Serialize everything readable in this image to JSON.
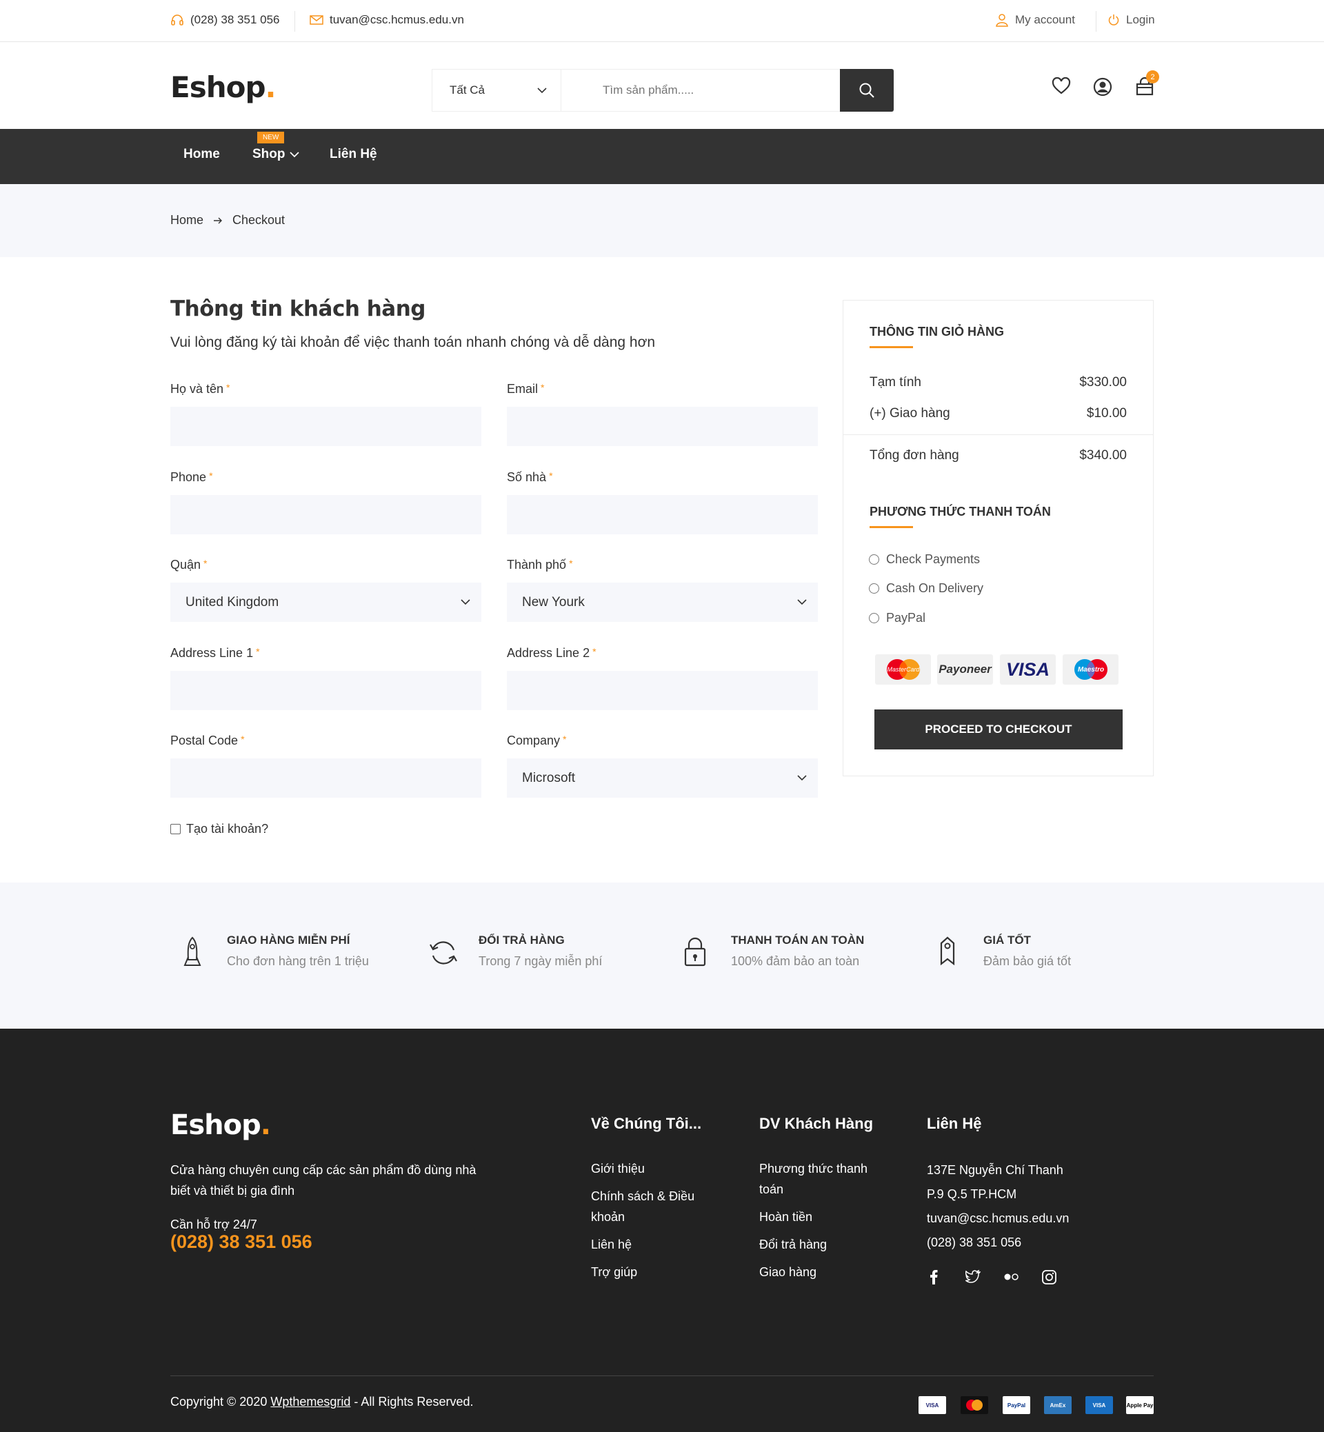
{
  "topbar": {
    "phone": "(028) 38 351 056",
    "email": "tuvan@csc.hcmus.edu.vn",
    "my_account": "My account",
    "login": "Login"
  },
  "header": {
    "logo_text": "Eshop",
    "logo_dot": ".",
    "search_category": "Tất Cả",
    "search_placeholder": "Tìm sản phẩm.....",
    "cart_count": "2"
  },
  "nav": {
    "items": [
      {
        "label": "Home"
      },
      {
        "label": "Shop",
        "tag": "NEW"
      },
      {
        "label": "Liên Hệ"
      }
    ]
  },
  "breadcrumb": {
    "home": "Home",
    "current": "Checkout"
  },
  "form": {
    "title": "Thông tin khách hàng",
    "subtitle": "Vui lòng đăng ký tài khoản để việc thanh toán nhanh chóng và dễ dàng hơn",
    "required_mark": "*",
    "fields": {
      "name": {
        "label": "Họ và tên"
      },
      "email": {
        "label": "Email"
      },
      "phone": {
        "label": "Phone"
      },
      "house": {
        "label": "Số nhà"
      },
      "district": {
        "label": "Quận",
        "value": "United Kingdom"
      },
      "city": {
        "label": "Thành phố",
        "value": "New Yourk"
      },
      "address1": {
        "label": "Address Line 1"
      },
      "address2": {
        "label": "Address Line 2"
      },
      "postal": {
        "label": "Postal Code"
      },
      "company": {
        "label": "Company",
        "value": "Microsoft"
      }
    },
    "create_account": "Tạo tài khoản?"
  },
  "cart": {
    "title": "THÔNG TIN GIỎ HÀNG",
    "subtotal_label": "Tạm tính",
    "subtotal_value": "$330.00",
    "shipping_label": "(+) Giao hàng",
    "shipping_value": "$10.00",
    "total_label": "Tổng đơn hàng",
    "total_value": "$340.00",
    "payment_title": "PHƯƠNG THỨC THANH TOÁN",
    "payment_options": [
      "Check Payments",
      "Cash On Delivery",
      "PayPal"
    ],
    "cards": [
      "MasterCard",
      "Payoneer",
      "VISA",
      "Maestro"
    ],
    "checkout_button": "PROCEED TO CHECKOUT"
  },
  "services": [
    {
      "title": "GIAO HÀNG MIỄN PHÍ",
      "desc": "Cho đơn hàng trên 1 triệu",
      "icon": "rocket-icon"
    },
    {
      "title": "ĐỔI TRẢ HÀNG",
      "desc": "Trong 7 ngày miễn phí",
      "icon": "refresh-icon"
    },
    {
      "title": "THANH TOÁN AN TOÀN",
      "desc": "100% đảm bảo an toàn",
      "icon": "lock-icon"
    },
    {
      "title": "GIÁ TỐT",
      "desc": "Đảm bảo giá tốt",
      "icon": "tag-icon"
    }
  ],
  "footer": {
    "logo_text": "Eshop",
    "logo_dot": ".",
    "about_line1": "Cửa hàng chuyên cung cấp các sản phẩm đồ dùng nhà",
    "about_line2": "biết và thiết bị gia đình",
    "support_label": "Cần hỗ trợ 24/7",
    "support_phone": "(028) 38 351 056",
    "col1": {
      "title": "Về Chúng Tôi...",
      "links": [
        "Giới thiệu",
        "Chính sách & Điều",
        "khoản",
        "Liên hệ",
        "Trợ giúp"
      ]
    },
    "col2": {
      "title": "DV Khách Hàng",
      "links": [
        "Phương thức thanh",
        "toán",
        "Hoàn tiền",
        "Đổi trả hàng",
        "Giao hàng"
      ]
    },
    "col3": {
      "title": "Liên Hệ",
      "lines": [
        "137E Nguyễn Chí Thanh",
        "P.9 Q.5 TP.HCM",
        "tuvan@csc.hcmus.edu.vn",
        "(028) 38 351 056"
      ]
    },
    "copyright_prefix": "Copyright © 2020 ",
    "copyright_link": "Wpthemesgrid",
    "copyright_suffix": " - All Rights Reserved.",
    "payment_icons": [
      "VISA",
      "MasterCard",
      "PayPal",
      "AmEx",
      "VISA",
      "Apple Pay"
    ]
  },
  "colors": {
    "accent": "#f7941d",
    "dark": "#333333",
    "footer_bg": "#222222",
    "light_bg": "#f6f7fb"
  }
}
